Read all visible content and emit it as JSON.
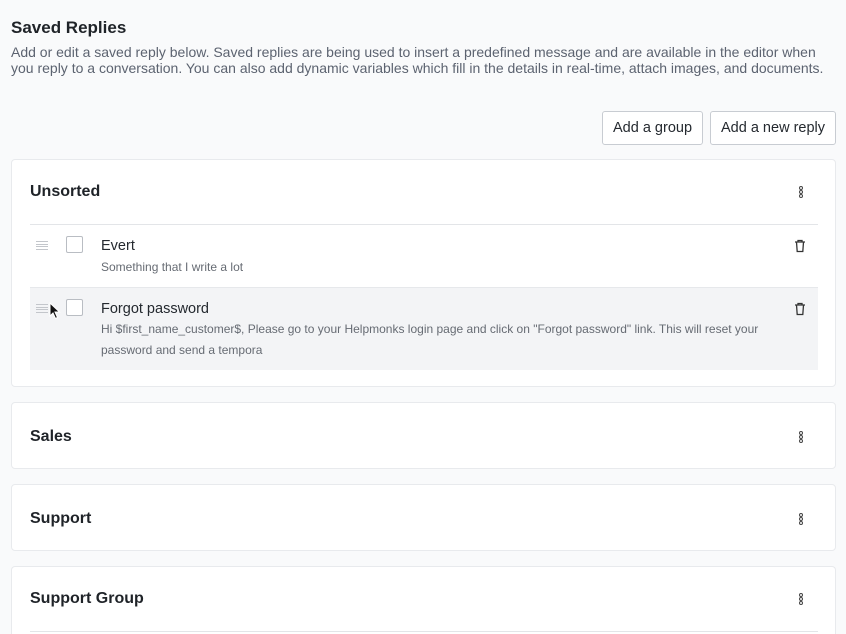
{
  "header": {
    "title": "Saved Replies",
    "description": "Add or edit a saved reply below. Saved replies are being used to insert a predefined message and are available in the editor when you reply to a conversation. You can also add dynamic variables which fill in the details in real-time, attach images, and documents."
  },
  "toolbar": {
    "add_group_label": "Add a group",
    "add_reply_label": "Add a new reply"
  },
  "groups": [
    {
      "name": "Unsorted",
      "replies": [
        {
          "title": "Evert",
          "body": "Something that I write a lot"
        },
        {
          "title": "Forgot password",
          "body": "Hi $first_name_customer$, Please go to your Helpmonks login page and click on \"Forgot password\" link. This will reset your password and send a tempora"
        }
      ]
    },
    {
      "name": "Sales"
    },
    {
      "name": "Support"
    },
    {
      "name": "Support Group"
    }
  ],
  "icons": {
    "more": "kebab-vertical-icon",
    "delete": "trash-icon",
    "drag": "drag-handle-icon"
  }
}
